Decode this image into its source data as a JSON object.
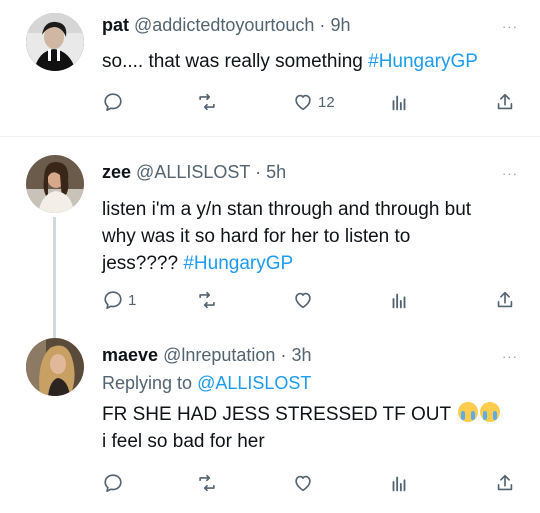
{
  "tweets": [
    {
      "name": "pat",
      "handle": "@addictedtoyourtouch",
      "dot": "·",
      "time": "9h",
      "text": "so.... that was really something ",
      "hashtag": "#HungaryGP",
      "replies": "",
      "retweets": "",
      "likes": "12"
    },
    {
      "name": "zee",
      "handle": "@ALLISLOST",
      "dot": "·",
      "time": "5h",
      "text_line1": "listen i'm a y/n stan through and through but",
      "text_line2": "why was it so hard for her to listen to",
      "text_line3": "jess???? ",
      "hashtag": "#HungaryGP",
      "replies": "1",
      "retweets": "",
      "likes": ""
    },
    {
      "name": "maeve",
      "handle": "@lnreputation",
      "dot": "·",
      "time": "3h",
      "replying_label": "Replying to ",
      "replying_handle": "@ALLISLOST",
      "text_line1": "FR SHE HAD JESS STRESSED TF OUT ",
      "text_line2": "i feel so bad for her",
      "emoji": [
        "loudly-crying-face",
        "loudly-crying-face"
      ],
      "replies": "",
      "retweets": "",
      "likes": ""
    }
  ],
  "more_label": "···",
  "colors": {
    "link": "#1d9bf0",
    "muted": "#536471",
    "text": "#0f1419",
    "divider": "#eff3f4"
  }
}
